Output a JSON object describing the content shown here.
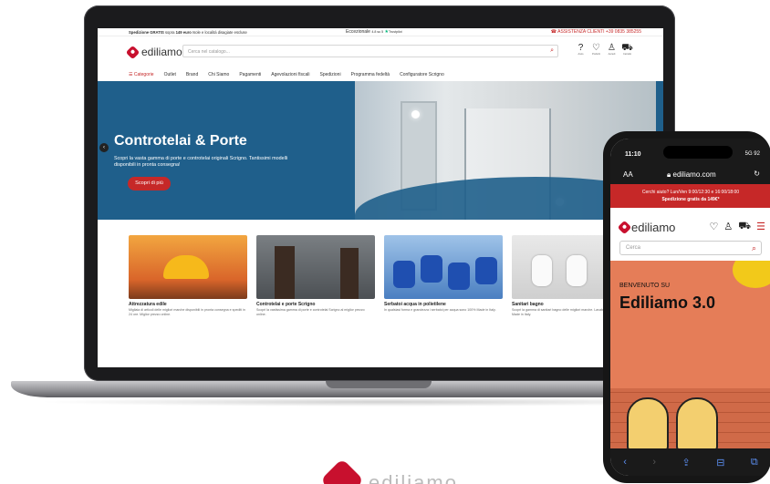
{
  "site": {
    "topbar": {
      "shipping_strong": "Spedizione GRATIS",
      "shipping_rest": " sopra ",
      "shipping_amount": "149 euro",
      "shipping_tail": " Isole e località disagiate escluse",
      "rating_label": "Eccezionale",
      "rating_score": "4.8 su 5",
      "trustpilot": "Trustpilot",
      "support": "ASSISTENZA CLIENTI +39 0835 385255"
    },
    "logo": "ediliamo",
    "search_placeholder": "Cerca nel catalogo...",
    "header_icons": [
      {
        "icon": "help-icon",
        "glyph": "?",
        "label": "Aiuto"
      },
      {
        "icon": "heart-icon",
        "glyph": "♡",
        "label": "Preferiti"
      },
      {
        "icon": "user-icon",
        "glyph": "♙",
        "label": "Accedi"
      },
      {
        "icon": "cart-icon",
        "glyph": "🛒",
        "label": "Carrello"
      }
    ],
    "nav": [
      "Categorie",
      "Outlet",
      "Brand",
      "Chi Siamo",
      "Pagamenti",
      "Agevolazioni fiscali",
      "Spedizioni",
      "Programma fedeltà",
      "Configuratore Scrigno"
    ],
    "hero": {
      "title": "Controtelai & Porte",
      "subtitle": "Scopri la vasta gamma di porte e controtelai originali Scrigno. Tantissimi modelli disponibili in pronta consegna!",
      "cta": "Scopri di più"
    },
    "categories": [
      {
        "title": "Attrezzatura edile",
        "desc": "Migliaia di articoli delle migliori marche disponibili in pronta consegna e spediti in 24 ore. Miglior prezzo online."
      },
      {
        "title": "Controtelai e porte Scrigno",
        "desc": "Scopri la vastissima gamma di porte e controtelai Scrigno al miglior prezzo online."
      },
      {
        "title": "Serbatoi acqua in polietilene",
        "desc": "In qualsiasi forma e grandezza i serbatoi per acqua sono 100% Made in Italy."
      },
      {
        "title": "Sanitari bagno",
        "desc": "Scopri la gamma di sanitari bagno delle migliori marche. Lavabi, wc e bidet 100% Made in Italy."
      }
    ]
  },
  "phone": {
    "time": "11:10",
    "battery": "5G 92",
    "aa": "AA",
    "url": "ediliamo.com",
    "strip_line1": "Cerchi aiuto?   Lun/Ven 9:00/12:30 e 16:00/18:00",
    "strip_line2": "Spedizione gratis da 149€*",
    "logo": "ediliamo",
    "menu_label": "MENU",
    "search_placeholder": "Cerca",
    "kicker": "BENVENUTO SU",
    "headline": "Ediliamo 3.0"
  },
  "brand_bottom": "ediliamo"
}
